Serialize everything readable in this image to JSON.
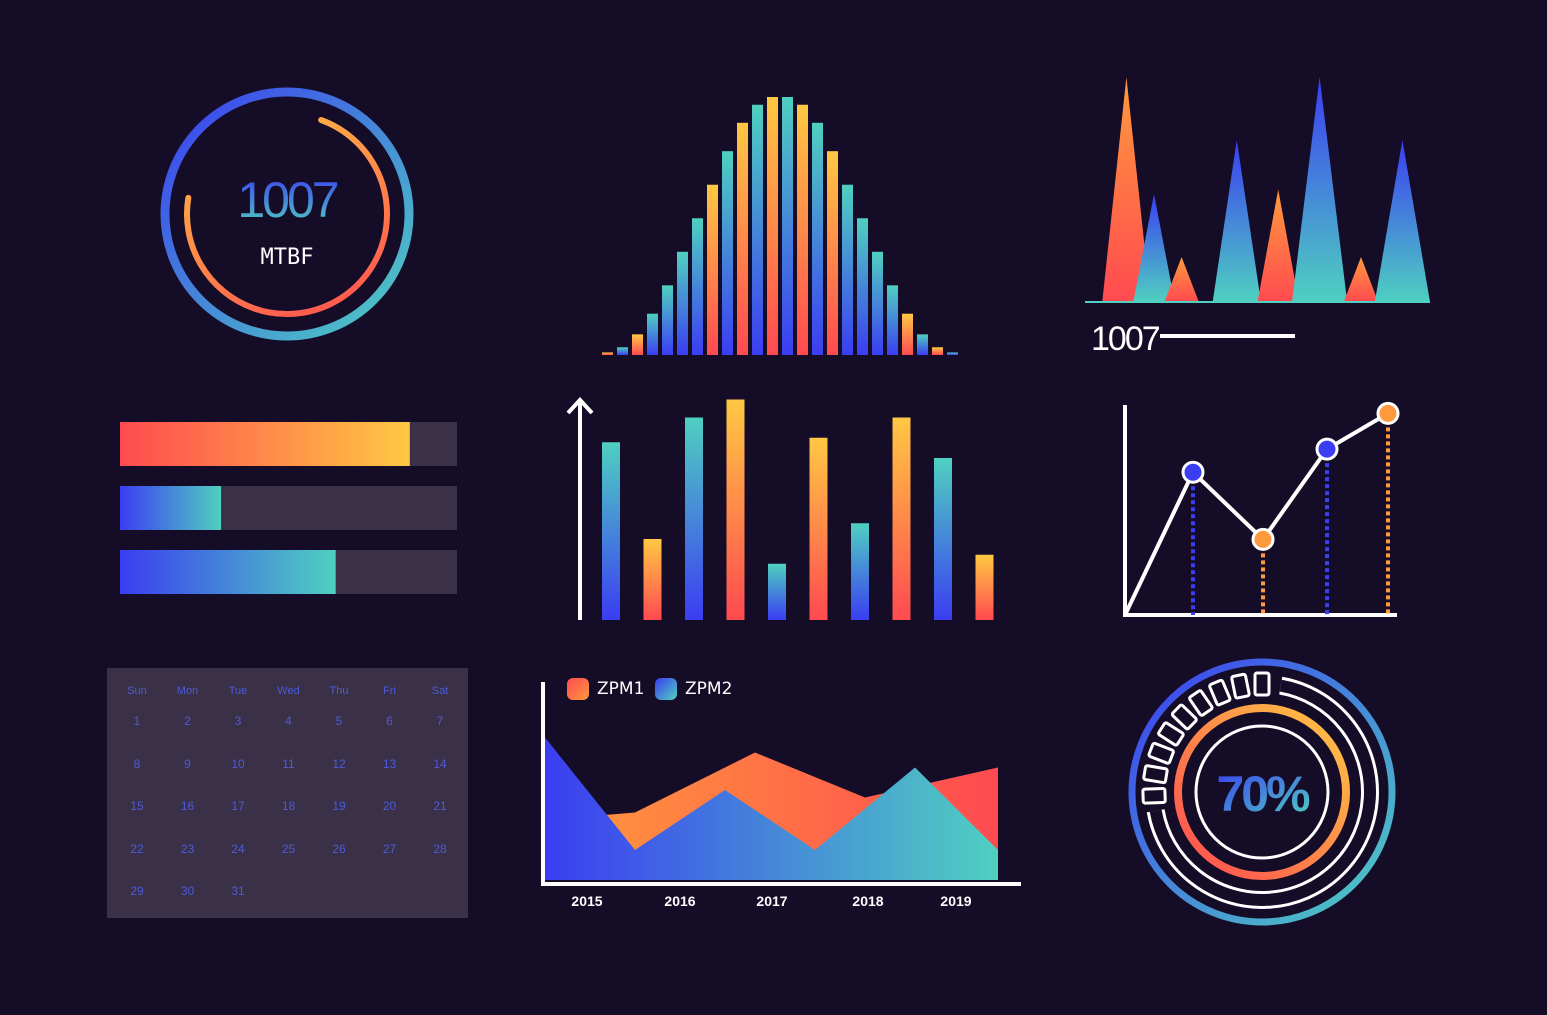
{
  "colors": {
    "background": "#150c28",
    "orange": "#ff9a3c",
    "red": "#ff4a50",
    "yellow": "#ffc843",
    "blue": "#3b3df2",
    "teal": "#4fd0c0",
    "track": "#3a3148",
    "white": "#ffffff"
  },
  "mtbf_gauge": {
    "value": "1007",
    "label": "MTBF",
    "outer_ring_fraction": 1.0,
    "inner_arc_fraction": 0.72
  },
  "progress_bars": [
    {
      "name": "bar-1",
      "fraction": 0.86,
      "gradient": [
        "#ff4a50",
        "#ffc843"
      ]
    },
    {
      "name": "bar-2",
      "fraction": 0.3,
      "gradient": [
        "#3b3df2",
        "#4fd0c0"
      ]
    },
    {
      "name": "bar-3",
      "fraction": 0.64,
      "gradient": [
        "#3b3df2",
        "#4fd0c0"
      ]
    }
  ],
  "calendar": {
    "weekdays": [
      "Sun",
      "Mon",
      "Tue",
      "Wed",
      "Thu",
      "Fri",
      "Sat"
    ],
    "days": [
      "1",
      "2",
      "3",
      "4",
      "5",
      "6",
      "7",
      "8",
      "9",
      "10",
      "11",
      "12",
      "13",
      "14",
      "15",
      "16",
      "17",
      "18",
      "19",
      "20",
      "21",
      "22",
      "23",
      "24",
      "25",
      "26",
      "27",
      "28",
      "29",
      "30",
      "31"
    ]
  },
  "peaks_chart_caption": "1007",
  "chart_data": [
    {
      "id": "bell-histogram",
      "type": "bar",
      "title": "",
      "values": [
        1,
        3,
        8,
        16,
        27,
        40,
        53,
        66,
        79,
        90,
        97,
        100,
        100,
        97,
        90,
        79,
        66,
        53,
        40,
        27,
        16,
        8,
        3,
        1
      ],
      "ylim": [
        0,
        100
      ]
    },
    {
      "id": "peaks-area",
      "type": "area",
      "title": "",
      "series": [
        {
          "values": [
            100,
            0,
            0,
            0,
            0,
            36,
            0,
            0,
            0,
            0,
            0,
            100,
            0,
            0,
            0,
            0,
            0,
            0,
            0
          ]
        },
        {
          "values": [
            0,
            0,
            48,
            0,
            0,
            0,
            0,
            0,
            0,
            0,
            0,
            0,
            0,
            0,
            62,
            0,
            0,
            0,
            0
          ]
        },
        {
          "values": [
            0,
            0,
            0,
            0,
            72,
            0,
            0,
            0,
            0,
            0,
            0,
            0,
            0,
            0,
            0,
            0,
            0,
            0,
            0
          ]
        },
        {
          "values": [
            0,
            0,
            0,
            0,
            0,
            0,
            0,
            0,
            0,
            0,
            0,
            0,
            0,
            0,
            0,
            0,
            0,
            0,
            0
          ]
        }
      ],
      "peaks": [
        {
          "x": 0.12,
          "h": 1.0,
          "w": 0.14,
          "color": "orange"
        },
        {
          "x": 0.2,
          "h": 0.48,
          "w": 0.12,
          "color": "blue"
        },
        {
          "x": 0.28,
          "h": 0.2,
          "w": 0.1,
          "color": "orange"
        },
        {
          "x": 0.44,
          "h": 0.72,
          "w": 0.14,
          "color": "blue"
        },
        {
          "x": 0.56,
          "h": 0.5,
          "w": 0.12,
          "color": "orange"
        },
        {
          "x": 0.68,
          "h": 1.0,
          "w": 0.16,
          "color": "blue"
        },
        {
          "x": 0.8,
          "h": 0.2,
          "w": 0.1,
          "color": "orange"
        },
        {
          "x": 0.92,
          "h": 0.72,
          "w": 0.16,
          "color": "blue"
        }
      ],
      "ylim": [
        0,
        100
      ]
    },
    {
      "id": "vertical-bars",
      "type": "bar",
      "title": "",
      "values": [
        79,
        36,
        90,
        98,
        25,
        81,
        43,
        90,
        72,
        29
      ],
      "ylim": [
        0,
        100
      ]
    },
    {
      "id": "line-points",
      "type": "line",
      "title": "",
      "x": [
        0,
        1,
        2,
        3,
        4
      ],
      "y": [
        0,
        68,
        36,
        79,
        96
      ],
      "point_colors": [
        "none",
        "blue",
        "orange",
        "blue",
        "orange"
      ],
      "ylim": [
        0,
        100
      ]
    },
    {
      "id": "zpm-area",
      "type": "area",
      "title": "",
      "categories": [
        "2015",
        "2016",
        "2017",
        "2018",
        "2019"
      ],
      "legend": [
        "ZPM1",
        "ZPM2"
      ],
      "series": [
        {
          "name": "ZPM1",
          "values": [
            30,
            22,
            62,
            40,
            55
          ]
        },
        {
          "name": "ZPM2",
          "values": [
            75,
            45,
            30,
            58,
            10
          ]
        }
      ],
      "ylim": [
        0,
        100
      ]
    },
    {
      "id": "radial-gauge",
      "type": "pie",
      "title": "",
      "value_label": "70%",
      "value": 70
    }
  ]
}
